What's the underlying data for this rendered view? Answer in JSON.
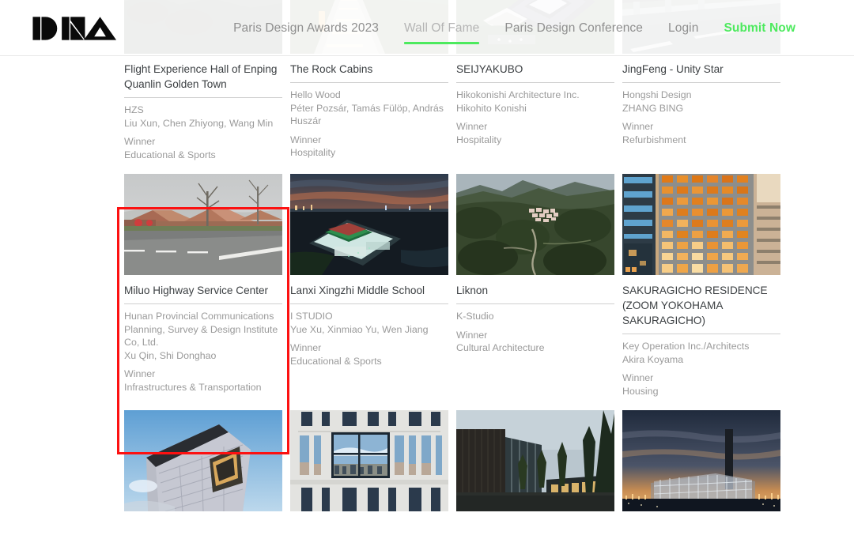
{
  "header": {
    "logo_text": "DNA",
    "logo_icon": "dna-wordmark-logo",
    "nav": [
      {
        "label": "Paris Design Awards 2023",
        "active": false,
        "cta": false
      },
      {
        "label": "Wall Of Fame",
        "active": true,
        "cta": false
      },
      {
        "label": "Paris Design Conference",
        "active": false,
        "cta": false
      },
      {
        "label": "Login",
        "active": false,
        "cta": false
      },
      {
        "label": "Submit Now",
        "active": false,
        "cta": true
      }
    ],
    "accent_color": "#4dea5e",
    "nav_text_color": "#8f8f8f",
    "active_text_color": "#b4b4b4"
  },
  "highlight": {
    "name": "selected-card-highlight",
    "color": "#fc1111",
    "target": "Miluo Highway Service Center"
  },
  "rows": [
    {
      "cards": [
        {
          "title": "Flight Experience Hall of Enping Quanlin Golden Town",
          "studio": "HZS",
          "authors": "Liu Xun, Chen Zhiyong, Wang Min",
          "award": "Winner",
          "category": "Educational & Sports",
          "image": "forest-ridge-pavilion-dusk"
        },
        {
          "title": "The Rock Cabins",
          "studio": "Hello Wood",
          "authors": "Péter Pozsár, Tamás Fülöp, András Huszár",
          "award": "Winner",
          "category": "Hospitality",
          "image": "lit-timber-boardwalk-cabin"
        },
        {
          "title": "SEIJYAKUBO",
          "studio": "Hikokonishi Architecture Inc.",
          "authors": "Hikohito Konishi",
          "award": "Winner",
          "category": "Hospitality",
          "image": "aerial-courtyard-complex-green"
        },
        {
          "title": "JingFeng - Unity Star",
          "studio": "Hongshi Design",
          "authors": "ZHANG BING",
          "award": "Winner",
          "category": "Refurbishment",
          "image": "elevated-highway-overpass"
        }
      ]
    },
    {
      "cards": [
        {
          "title": "Miluo Highway Service Center",
          "studio": "Hunan Provincial Communications Planning, Survey & Design Institute Co, Ltd.",
          "authors": "Xu Qin, Shi Donghao",
          "award": "Winner",
          "category": "Infrastructures & Transportation",
          "image": "brick-roof-service-center-overcast"
        },
        {
          "title": "Lanxi Xingzhi Middle School",
          "studio": "I STUDIO",
          "authors": "Yue Xu, Xinmiao Yu, Wen Jiang",
          "award": "Winner",
          "category": "Educational & Sports",
          "image": "aerial-school-campus-sunset"
        },
        {
          "title": "Liknon",
          "studio": "K-Studio",
          "authors": "",
          "award": "Winner",
          "category": "Cultural Architecture",
          "image": "hillside-village-mountains"
        },
        {
          "title": "SAKURAGICHO RESIDENCE (ZOOM YOKOHAMA SAKURAGICHO)",
          "studio": "Key Operation Inc./Architects",
          "authors": "Akira Koyama",
          "award": "Winner",
          "category": "Housing",
          "image": "lit-window-grid-facade-dusk"
        }
      ]
    },
    {
      "cards": [
        {
          "title": "",
          "studio": "",
          "authors": "",
          "award": "",
          "category": "",
          "image": "angular-stone-clad-building-blue-sky"
        },
        {
          "title": "",
          "studio": "",
          "authors": "",
          "award": "",
          "category": "",
          "image": "white-facade-reflective-windows"
        },
        {
          "title": "",
          "studio": "",
          "authors": "",
          "award": "",
          "category": "",
          "image": "dark-timber-house-pine-forest"
        },
        {
          "title": "",
          "studio": "",
          "authors": "",
          "award": "",
          "category": "",
          "image": "glass-pavilion-city-dusk-chimney"
        }
      ]
    }
  ]
}
